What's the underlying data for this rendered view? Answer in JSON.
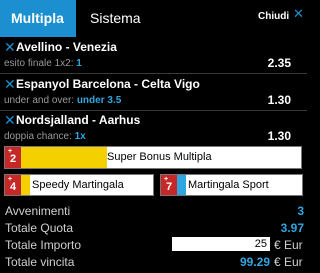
{
  "tabs": {
    "multipla": "Multipla",
    "sistema": "Sistema",
    "close_label": "Chiudi",
    "close_icon": "close-icon"
  },
  "bets": [
    {
      "match": "Avellino - Venezia",
      "market": "esito finale 1x2: ",
      "pick": "1",
      "odd": "2.35"
    },
    {
      "match": "Espanyol Barcelona - Celta Vigo",
      "market": "under and over: ",
      "pick": "under 3.5",
      "odd": "1.30"
    },
    {
      "match": "Nordsjalland - Aarhus",
      "market": "doppia chance: ",
      "pick": "1x",
      "odd": "1.30"
    }
  ],
  "bonuses": {
    "super": {
      "number": "2",
      "label": "Super Bonus Multipla",
      "fill_color": "#f5d000"
    },
    "speedy": {
      "number": "4",
      "label": "Speedy Martingala",
      "fill_color": "#f5d000"
    },
    "sport": {
      "number": "7",
      "label": "Martingala Sport",
      "fill_color": "#2fa6e0"
    }
  },
  "totals": {
    "avvenimenti_label": "Avvenimenti",
    "avvenimenti": "3",
    "quota_label": "Totale Quota",
    "quota": "3.97",
    "importo_label": "Totale Importo",
    "importo": "25",
    "currency": "€ Eur",
    "vincita_label": "Totale vincita",
    "vincita": "99.29"
  },
  "colors": {
    "accent": "#1b8fcf",
    "value_blue": "#2fa6e0",
    "bonus_red": "#c62828",
    "bonus_yellow": "#f5d000"
  }
}
